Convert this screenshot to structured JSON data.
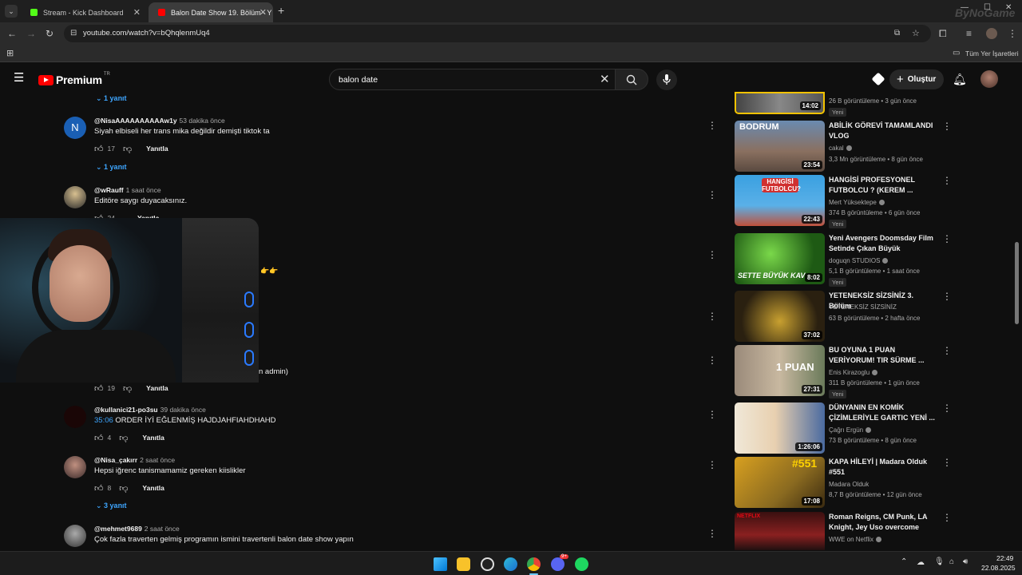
{
  "browser": {
    "tabs": [
      {
        "label": "Stream - Kick Dashboard",
        "close": "✕"
      },
      {
        "label": "Balon Date Show 19. Bölüm - Y",
        "close": "✕"
      }
    ],
    "new_tab": "+",
    "url": "youtube.com/watch?v=bQhqlenmUq4",
    "bookmarks_label": "Tüm Yer İşaretleri",
    "watermark": "ByNoGame"
  },
  "youtube": {
    "logo": "Premium",
    "logo_region": "TR",
    "search_value": "balon date",
    "create_label": "Oluştur"
  },
  "comments": {
    "top_replies": "1 yanıt",
    "items": [
      {
        "author": "@NisaAAAAAAAAAAw1y",
        "time": "53 dakika önce",
        "text": "Siyah elbiseli her trans mika değildir demişti tiktok ta",
        "likes": "17",
        "reply": "Yanıtla",
        "replies": "1 yanıt",
        "avatar_letter": "N"
      },
      {
        "author": "@wRauff",
        "time": "1 saat önce",
        "text": "Editöre saygı duyacaksınız.",
        "likes": "24",
        "reply": "Yanıtla"
      },
      {
        "text_partial": "n admin)",
        "emoji": "👉👉",
        "likes": "19",
        "reply": "Yanıtla"
      },
      {
        "author": "@kullanici21-po3su",
        "time": "39 dakika önce",
        "timestamp_link": "35:06",
        "text": "ORDER İYİ EĞLENMİŞ HAJDJAHFIAHDHAHD",
        "likes": "4",
        "reply": "Yanıtla"
      },
      {
        "author": "@Nisa_çakırr",
        "time": "2 saat önce",
        "text": "Hepsi iğrenc tanismamamiz gereken kiislikler",
        "likes": "8",
        "reply": "Yanıtla",
        "replies": "3 yanıt"
      },
      {
        "author": "@mehmet9689",
        "time": "2 saat önce",
        "text": "Çok fazla traverten gelmiş programın ismini travertenli balon date show yapın"
      }
    ]
  },
  "sidebar": {
    "items": [
      {
        "title": "",
        "channel": "",
        "meta": "26 B görüntüleme • 3 gün önce",
        "badge": "Yeni",
        "duration": "14:02"
      },
      {
        "title": "ABİLİK GÖREVİ TAMAMLANDI VLOG",
        "channel": "cakal",
        "meta": "3,3 Mn görüntüleme • 8 gün önce",
        "duration": "23:54",
        "thumb_text": "BODRUM"
      },
      {
        "title": "HANGİSİ PROFESYONEL FUTBOLCU ? (KEREM ...",
        "channel": "Mert Yüksektepe",
        "meta": "374 B görüntüleme • 6 gün önce",
        "badge": "Yeni",
        "duration": "22:43",
        "thumb_text": "HANGİSİ FUTBOLCU?"
      },
      {
        "title": "Yeni Avengers Doomsday Film Setinde Çıkan Büyük Kavganın...",
        "channel": "doguqn STUDIOS",
        "meta": "5,1 B görüntüleme • 1 saat önce",
        "badge": "Yeni",
        "duration": "8:02",
        "thumb_text": "SETTE BÜYÜK KAV"
      },
      {
        "title": "YETENEKSİZ SİZSİNİZ 3. Bölüm",
        "channel": "YETENEKSİZ SİZSİNİZ",
        "meta": "63 B görüntüleme • 2 hafta önce",
        "duration": "37:02"
      },
      {
        "title": "BU OYUNA 1 PUAN VERİYORUM! TIR SÜRME ...",
        "channel": "Enis Kirazoglu",
        "meta": "311 B görüntüleme • 1 gün önce",
        "badge": "Yeni",
        "duration": "27:31",
        "thumb_text": "1 PUAN"
      },
      {
        "title": "DÜNYANIN EN KOMİK ÇİZİMLERİYLE GARTIC YENİ ...",
        "channel": "Çağrı Ergün",
        "meta": "73 B görüntüleme • 8 gün önce",
        "duration": "1:26:06"
      },
      {
        "title": "KAPA HİLEYİ | Madara Olduk #551",
        "channel": "Madara Olduk",
        "meta": "8,7 B görüntüleme • 12 gün önce",
        "duration": "17:08",
        "thumb_text": "#551"
      },
      {
        "title": "Roman Reigns, CM Punk, LA Knight, Jey Uso overcome The...",
        "channel": "WWE on Netflix",
        "meta": "",
        "duration": "",
        "thumb_text": "NETFLIX"
      }
    ]
  },
  "taskbar": {
    "time": "22:49",
    "date": "22.08.2025",
    "discord_badge": "9+"
  }
}
